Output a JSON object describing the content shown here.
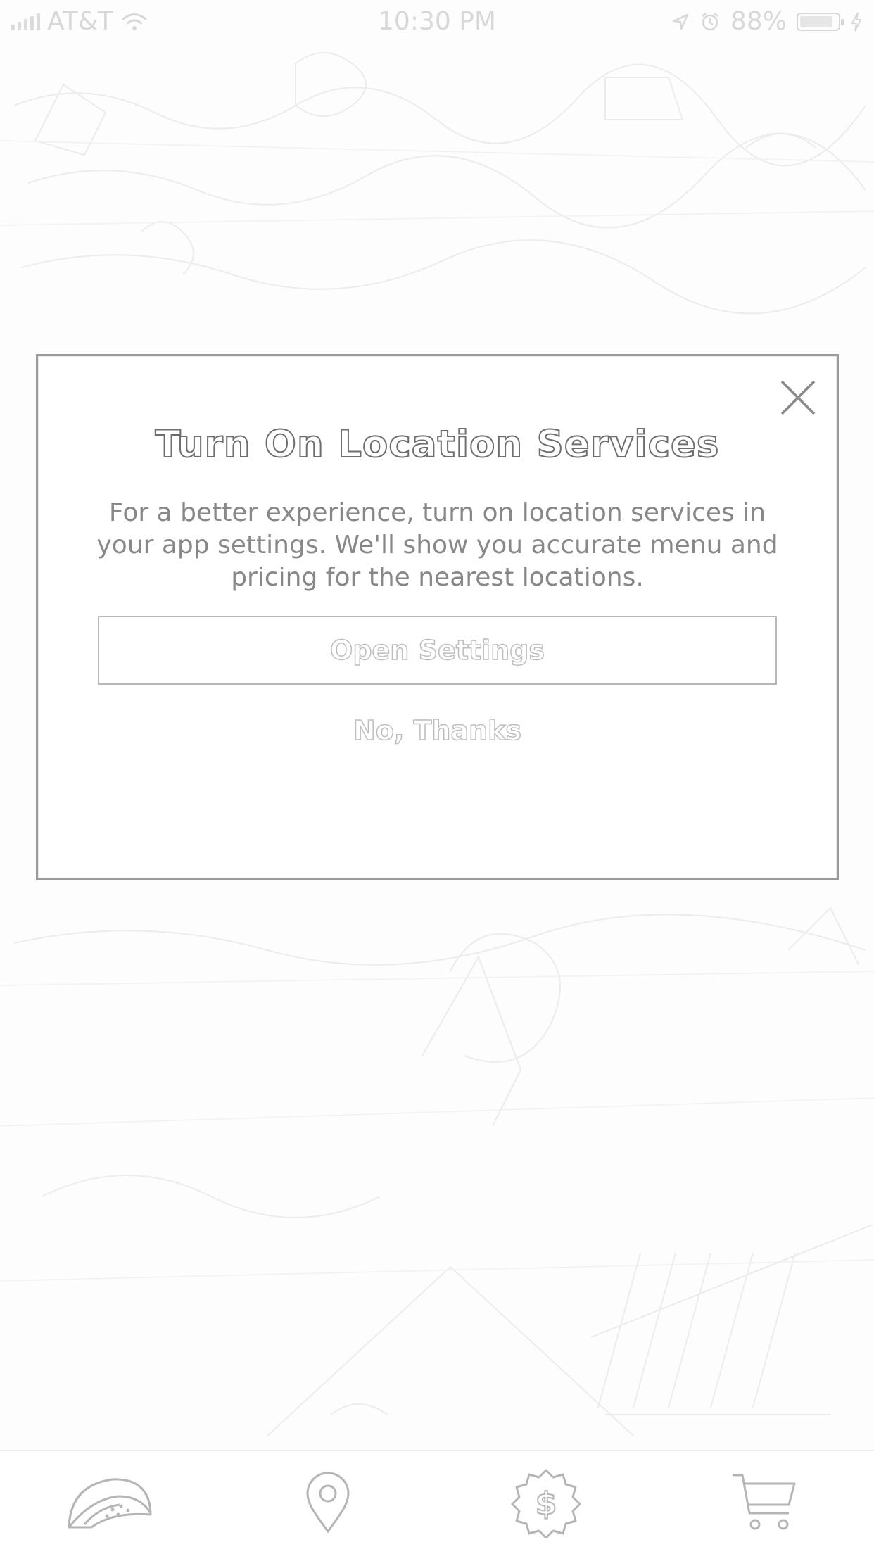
{
  "status_bar": {
    "carrier": "AT&T",
    "time": "10:30 PM",
    "battery": "88%",
    "icons": [
      "signal-icon",
      "wifi-icon",
      "location-arrow-icon",
      "alarm-icon",
      "battery-icon",
      "charging-icon"
    ]
  },
  "modal": {
    "title": "Turn On Location Services",
    "body": "For a better experience, turn on location services in your app settings. We'll show you accurate menu and pricing for the nearest locations.",
    "primary_button": "Open Settings",
    "secondary_button": "No, Thanks",
    "close_icon": "close-icon"
  },
  "tab_bar": {
    "tabs": [
      {
        "icon": "taco-icon"
      },
      {
        "icon": "location-pin-icon"
      },
      {
        "icon": "dollar-badge-icon"
      },
      {
        "icon": "cart-icon"
      }
    ]
  },
  "colors": {
    "border": "#9a9a9a",
    "title_outline": "#6e6e6e",
    "body_text": "#888888",
    "muted": "#bdbdbd"
  }
}
